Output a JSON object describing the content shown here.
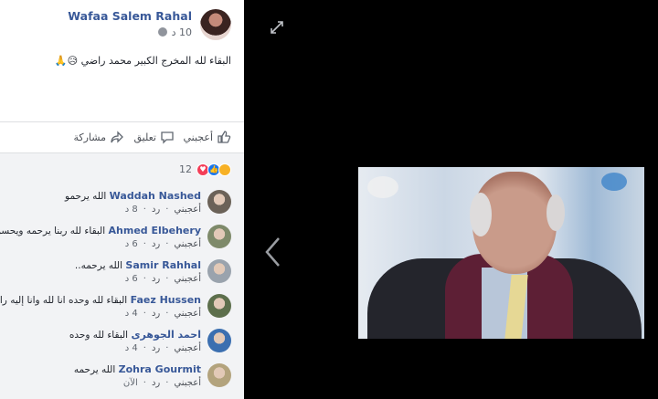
{
  "post": {
    "author": "Wafaa Salem Rahal",
    "time": "10 د",
    "text": "البقاء لله المخرج الكبير محمد راضي 😥🙏",
    "actions": {
      "like": "أعجبني",
      "comment": "تعليق",
      "share": "مشاركة"
    },
    "reactions": {
      "count": "12",
      "icons": [
        "sad-reaction-icon",
        "like-reaction-icon",
        "love-reaction-icon"
      ]
    }
  },
  "comments": [
    {
      "name": "Waddah Nashed",
      "text": "الله يرحمو",
      "like": "أعجبني",
      "reply": "رد",
      "time": "8 د",
      "avatar_color": "#6b6258"
    },
    {
      "name": "Ahmed Elbehery",
      "text": "البقاء لله ربنا يرحمه ويحسن إليه",
      "like": "أعجبني",
      "reply": "رد",
      "time": "6 د",
      "avatar_color": "#7e8a6a"
    },
    {
      "name": "Samir Rahhal",
      "text": "الله يرحمه..",
      "like": "أعجبني",
      "reply": "رد",
      "time": "6 د",
      "avatar_color": "#9aa3ad"
    },
    {
      "name": "Faez Hussen",
      "text": "البقاء لله وحده انا لله وانا إليه راجعون",
      "like": "أعجبني",
      "reply": "رد",
      "time": "4 د",
      "avatar_color": "#5d6f4c"
    },
    {
      "name": "احمد الجوهرى",
      "text": "البقاء لله وحده",
      "like": "أعجبني",
      "reply": "رد",
      "time": "4 د",
      "avatar_color": "#3b6fb0"
    },
    {
      "name": "Zohra Gourmit",
      "text": "الله يرحمه",
      "like": "أعجبني",
      "reply": "رد",
      "time": "الآن",
      "avatar_color": "#b3a37d"
    }
  ],
  "viewer": {
    "background": "#000000"
  }
}
